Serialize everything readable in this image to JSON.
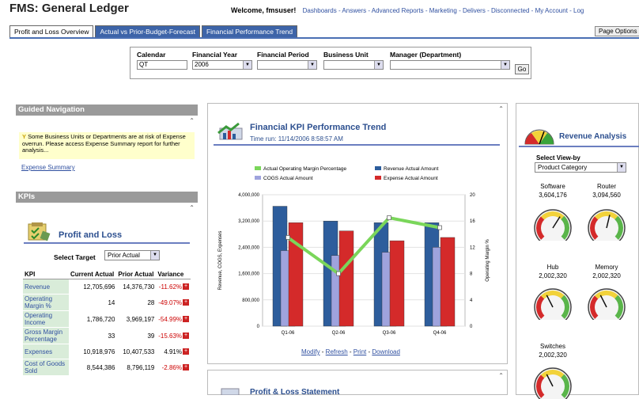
{
  "app": {
    "title": "FMS: General Ledger"
  },
  "topnav": {
    "welcome": "Welcome, fmsuser!",
    "links": [
      "Dashboards",
      "Answers",
      "Advanced Reports",
      "Marketing",
      "Delivers",
      "Disconnected",
      "My Account",
      "Log"
    ]
  },
  "tabs": [
    {
      "label": "Profit and Loss Overview",
      "active": true
    },
    {
      "label": "Actual vs Prior-Budget-Forecast",
      "active": false
    },
    {
      "label": "Financial Performance Trend",
      "active": false
    }
  ],
  "page_options": "Page Options",
  "prompts": {
    "calendar": {
      "label": "Calendar",
      "value": "QT"
    },
    "financial_year": {
      "label": "Financial Year",
      "value": "2006"
    },
    "financial_period": {
      "label": "Financial Period",
      "value": ""
    },
    "business_unit": {
      "label": "Business Unit",
      "value": ""
    },
    "manager": {
      "label": "Manager (Department)",
      "value": ""
    },
    "go": "Go"
  },
  "guided_nav": {
    "title": "Guided Navigation",
    "note": "Some Business Units or Departments are at risk of Expense overrun. Please access Expense Summary report for further analysis...",
    "link": "Expense Summary"
  },
  "kpis": {
    "title": "KPIs",
    "section_title": "Profit and Loss",
    "select_target_label": "Select Target",
    "select_target_value": "Prior Actual",
    "columns": [
      "KPI",
      "Current Actual",
      "Prior Actual",
      "Variance"
    ],
    "rows": [
      {
        "kpi": "Revenue",
        "current": "12,705,696",
        "prior": "14,376,730",
        "variance": "-11.62%",
        "flag": true
      },
      {
        "kpi": "Operating Margin %",
        "current": "14",
        "prior": "28",
        "variance": "-49.07%",
        "flag": true
      },
      {
        "kpi": "Operating Income",
        "current": "1,786,720",
        "prior": "3,969,197",
        "variance": "-54.99%",
        "flag": true
      },
      {
        "kpi": "Gross Margin Percentage",
        "current": "33",
        "prior": "39",
        "variance": "-15.63%",
        "flag": true
      },
      {
        "kpi": "Expenses",
        "current": "10,918,976",
        "prior": "10,407,533",
        "variance": "4.91%",
        "flag": true
      },
      {
        "kpi": "Cost of Goods Sold",
        "current": "8,544,386",
        "prior": "8,796,119",
        "variance": "-2.86%",
        "flag": true
      }
    ]
  },
  "trend": {
    "title": "Financial KPI Performance Trend",
    "time_run": "Time run: 11/14/2006 8:58:57 AM",
    "links": [
      "Modify",
      "Refresh",
      "Print",
      "Download"
    ]
  },
  "chart_data": {
    "type": "bar",
    "categories": [
      "Q1-06",
      "Q2-06",
      "Q3-06",
      "Q4-06"
    ],
    "series": [
      {
        "name": "COGS Actual Amount",
        "values": [
          2300000,
          2150000,
          2250000,
          2400000
        ],
        "color": "#9fa3dd"
      },
      {
        "name": "Revenue Actual Amount",
        "values": [
          3650000,
          3200000,
          3150000,
          3150000
        ],
        "color": "#2d5d9c"
      },
      {
        "name": "Expense Actual Amount",
        "values": [
          3150000,
          2900000,
          2600000,
          2700000
        ],
        "color": "#d42a2a"
      }
    ],
    "line_series": {
      "name": "Actual Operating Margin Percentage",
      "values": [
        13.5,
        8.0,
        16.5,
        15.0
      ],
      "color": "#7ad65a",
      "axis": "right"
    },
    "legend": [
      "Actual Operating Margin Percentage",
      "Revenue Actual Amount",
      "COGS Actual Amount",
      "Expense Actual Amount"
    ],
    "ylabel": "Revenue, COGS, Expenses",
    "y2label": "Operating Margin %",
    "ylim": [
      0,
      4000000
    ],
    "y2lim": [
      0,
      20
    ],
    "yticks": [
      "0",
      "800,000",
      "1,600,000",
      "2,400,000",
      "3,200,000",
      "4,000,000"
    ],
    "y2ticks": [
      "0",
      "4",
      "8",
      "12",
      "16",
      "20"
    ]
  },
  "pl_statement": {
    "title": "Profit & Loss Statement"
  },
  "revenue_analysis": {
    "title": "Revenue Analysis",
    "select_label": "Select View-by",
    "select_value": "Product Category",
    "gauges": [
      {
        "label": "Software",
        "value": "3,604,176",
        "level": 0.62
      },
      {
        "label": "Router",
        "value": "3,094,560",
        "level": 0.55
      },
      {
        "label": "Hub",
        "value": "2,002,320",
        "level": 0.4
      },
      {
        "label": "Memory",
        "value": "2,002,320",
        "level": 0.4
      },
      {
        "label": "Switches",
        "value": "2,002,320",
        "level": 0.4
      }
    ]
  }
}
